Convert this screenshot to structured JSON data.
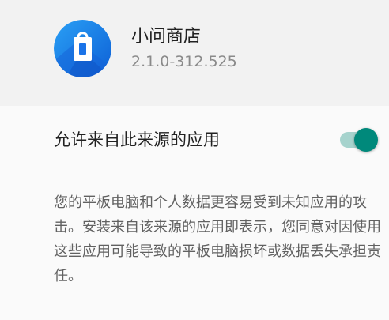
{
  "app": {
    "name": "小问商店",
    "version": "2.1.0-312.525",
    "icon": "shopping-bag-icon",
    "icon_color": "#1e88e5"
  },
  "setting": {
    "label": "允许来自此来源的应用",
    "toggle_state": "on",
    "toggle_color": "#00897b"
  },
  "warning": {
    "text": "您的平板电脑和个人数据更容易受到未知应用的攻击。安装来自该来源的应用即表示，您同意对因使用这些应用可能导致的平板电脑损坏或数据丢失承担责任。"
  }
}
